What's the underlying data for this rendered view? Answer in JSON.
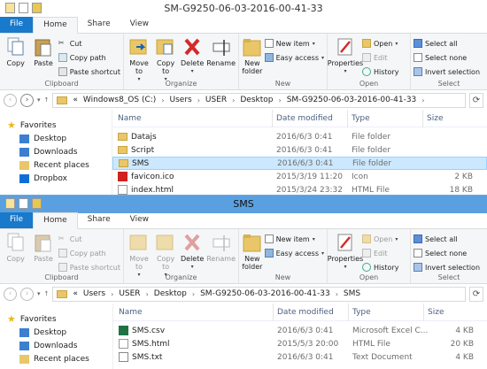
{
  "top": {
    "title": "SM-G9250-06-03-2016-00-41-33",
    "tabs": [
      "File",
      "Home",
      "Share",
      "View"
    ],
    "clipboard": {
      "copy": "Copy",
      "paste": "Paste",
      "cut": "Cut",
      "copy_path": "Copy path",
      "paste_shortcut": "Paste shortcut",
      "label": "Clipboard"
    },
    "organize": {
      "move_to": "Move to",
      "copy_to": "Copy to",
      "delete": "Delete",
      "rename": "Rename",
      "label": "Organize"
    },
    "new": {
      "new_folder": "New folder",
      "new_item": "New item",
      "easy_access": "Easy access",
      "label": "New"
    },
    "open": {
      "properties": "Properties",
      "open": "Open",
      "edit": "Edit",
      "history": "History",
      "label": "Open"
    },
    "select": {
      "select_all": "Select all",
      "select_none": "Select none",
      "invert": "Invert selection",
      "label": "Select"
    },
    "address": [
      "«",
      "Windows8_OS (C:)",
      "Users",
      "USER",
      "Desktop",
      "SM-G9250-06-03-2016-00-41-33"
    ],
    "columns": {
      "name": "Name",
      "date": "Date modified",
      "type": "Type",
      "size": "Size"
    },
    "nav": {
      "favorites": "Favorites",
      "items": [
        "Desktop",
        "Downloads",
        "Recent places",
        "Dropbox"
      ]
    },
    "files": [
      {
        "name": "Datajs",
        "date": "2016/6/3 0:41",
        "type": "File folder",
        "size": "",
        "icon": "folder"
      },
      {
        "name": "Script",
        "date": "2016/6/3 0:41",
        "type": "File folder",
        "size": "",
        "icon": "folder"
      },
      {
        "name": "SMS",
        "date": "2016/6/3 0:41",
        "type": "File folder",
        "size": "",
        "icon": "folder"
      },
      {
        "name": "favicon.ico",
        "date": "2015/3/19 11:20",
        "type": "Icon",
        "size": "2 KB",
        "icon": "ico"
      },
      {
        "name": "index.html",
        "date": "2015/3/24 23:32",
        "type": "HTML File",
        "size": "18 KB",
        "icon": "html"
      }
    ]
  },
  "bottom": {
    "title": "SMS",
    "tabs": [
      "File",
      "Home",
      "Share",
      "View"
    ],
    "clipboard": {
      "copy": "Copy",
      "paste": "Paste",
      "cut": "Cut",
      "copy_path": "Copy path",
      "paste_shortcut": "Paste shortcut",
      "label": "Clipboard"
    },
    "organize": {
      "move_to": "Move to",
      "copy_to": "Copy to",
      "delete": "Delete",
      "rename": "Rename",
      "label": "Organize"
    },
    "new": {
      "new_folder": "New folder",
      "new_item": "New item",
      "easy_access": "Easy access",
      "label": "New"
    },
    "open": {
      "properties": "Properties",
      "open": "Open",
      "edit": "Edit",
      "history": "History",
      "label": "Open"
    },
    "select": {
      "select_all": "Select all",
      "select_none": "Select none",
      "invert": "Invert selection",
      "label": "Select"
    },
    "address": [
      "«",
      "Users",
      "USER",
      "Desktop",
      "SM-G9250-06-03-2016-00-41-33",
      "SMS"
    ],
    "columns": {
      "name": "Name",
      "date": "Date modified",
      "type": "Type",
      "size": "Size"
    },
    "nav": {
      "favorites": "Favorites",
      "items": [
        "Desktop",
        "Downloads",
        "Recent places"
      ]
    },
    "files": [
      {
        "name": "SMS.csv",
        "date": "2016/6/3 0:41",
        "type": "Microsoft Excel C...",
        "size": "4 KB",
        "icon": "csv"
      },
      {
        "name": "SMS.html",
        "date": "2015/5/3 20:00",
        "type": "HTML File",
        "size": "20 KB",
        "icon": "html"
      },
      {
        "name": "SMS.txt",
        "date": "2016/6/3 0:41",
        "type": "Text Document",
        "size": "4 KB",
        "icon": "txt"
      }
    ]
  }
}
